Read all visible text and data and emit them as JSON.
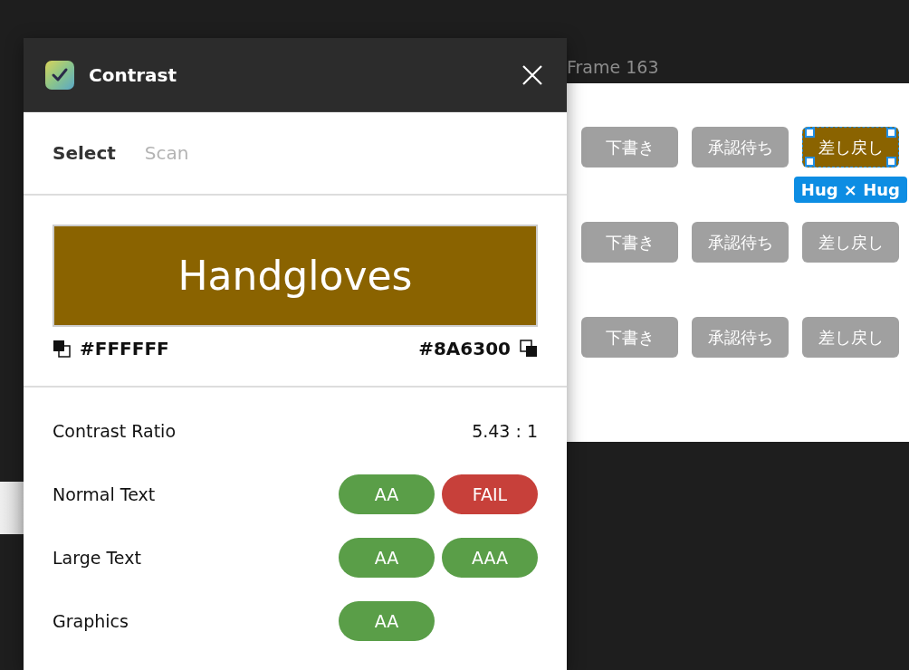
{
  "canvas": {
    "frame_title": "Frame 163",
    "size_label": "Hug × Hug",
    "rows": [
      [
        {
          "label": "下書き",
          "selected": false
        },
        {
          "label": "承認待ち",
          "selected": false
        },
        {
          "label": "差し戻し",
          "selected": true
        }
      ],
      [
        {
          "label": "下書き",
          "selected": false
        },
        {
          "label": "承認待ち",
          "selected": false
        },
        {
          "label": "差し戻し",
          "selected": false
        }
      ],
      [
        {
          "label": "下書き",
          "selected": false
        },
        {
          "label": "承認待ち",
          "selected": false
        },
        {
          "label": "差し戻し",
          "selected": false
        }
      ]
    ]
  },
  "plugin": {
    "title": "Contrast",
    "tabs": [
      {
        "label": "Select",
        "selected": true
      },
      {
        "label": "Scan",
        "selected": false
      }
    ],
    "preview": {
      "sample_text": "Handgloves",
      "foreground": "#FFFFFF",
      "background": "#8A6300"
    },
    "ratio": {
      "label": "Contrast Ratio",
      "value": "5.43 : 1"
    },
    "checks": [
      {
        "label": "Normal Text",
        "badges": [
          {
            "text": "AA",
            "pass": true
          },
          {
            "text": "FAIL",
            "pass": false
          }
        ]
      },
      {
        "label": "Large Text",
        "badges": [
          {
            "text": "AA",
            "pass": true
          },
          {
            "text": "AAA",
            "pass": true
          }
        ]
      },
      {
        "label": "Graphics",
        "badges": [
          {
            "text": "AA",
            "pass": true
          }
        ]
      }
    ]
  }
}
